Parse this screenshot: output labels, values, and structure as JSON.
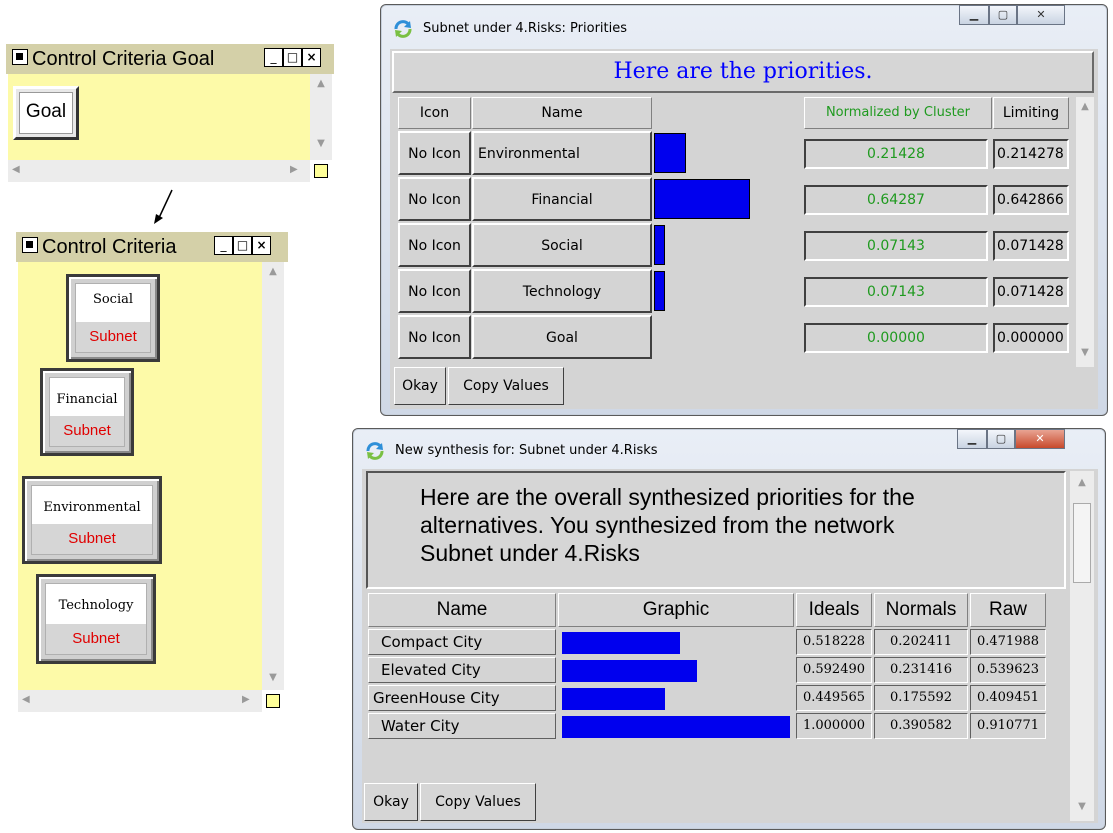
{
  "goal_window": {
    "title": "Control Criteria Goal",
    "buttons": [
      "_",
      "□",
      "×"
    ],
    "node_label": "Goal"
  },
  "criteria_window": {
    "title": "Control Criteria",
    "buttons": [
      "_",
      "□",
      "×"
    ],
    "nodes": [
      {
        "name": "Social",
        "sub": "Subnet"
      },
      {
        "name": "Financial",
        "sub": "Subnet"
      },
      {
        "name": "Environmental",
        "sub": "Subnet"
      },
      {
        "name": "Technology",
        "sub": "Subnet"
      }
    ]
  },
  "priorities_window": {
    "title": "Subnet under 4.Risks: Priorities",
    "heading": "Here are the priorities.",
    "columns": {
      "icon": "Icon",
      "name": "Name",
      "normalized": "Normalized by Cluster",
      "limiting": "Limiting"
    },
    "rows": [
      {
        "icon": "No Icon",
        "name": "Environmental",
        "bar": 0.21428,
        "normalized": "0.21428",
        "limiting": "0.214278"
      },
      {
        "icon": "No Icon",
        "name": "Financial",
        "bar": 0.64287,
        "normalized": "0.64287",
        "limiting": "0.642866"
      },
      {
        "icon": "No Icon",
        "name": "Social",
        "bar": 0.07143,
        "normalized": "0.07143",
        "limiting": "0.071428"
      },
      {
        "icon": "No Icon",
        "name": "Technology",
        "bar": 0.07143,
        "normalized": "0.07143",
        "limiting": "0.071428"
      },
      {
        "icon": "No Icon",
        "name": "Goal",
        "bar": 0.0,
        "normalized": "0.00000",
        "limiting": "0.000000"
      }
    ],
    "okay": "Okay",
    "copy": "Copy Values"
  },
  "synthesis_window": {
    "title": "New synthesis for: Subnet under 4.Risks",
    "heading_lines": [
      "Here are the overall synthesized priorities for the",
      "alternatives.  You synthesized from the network",
      "Subnet under 4.Risks"
    ],
    "columns": {
      "name": "Name",
      "graphic": "Graphic",
      "ideals": "Ideals",
      "normals": "Normals",
      "raw": "Raw"
    },
    "rows": [
      {
        "name": "Compact City",
        "ideal": 0.518228,
        "ideals": "0.518228",
        "normals": "0.202411",
        "raw": "0.471988"
      },
      {
        "name": "Elevated City",
        "ideal": 0.59249,
        "ideals": "0.592490",
        "normals": "0.231416",
        "raw": "0.539623"
      },
      {
        "name": "GreenHouse City",
        "ideal": 0.449565,
        "ideals": "0.449565",
        "normals": "0.175592",
        "raw": "0.409451"
      },
      {
        "name": "Water City",
        "ideal": 1.0,
        "ideals": "1.000000",
        "normals": "0.390582",
        "raw": "0.910771"
      }
    ],
    "okay": "Okay",
    "copy": "Copy Values"
  },
  "colors": {
    "bar": "#0000ee",
    "heading_blue": "#0000ff",
    "green_value": "#1f9a1f",
    "subnet_red": "#e00000",
    "canvas_yellow": "#fdfaa8"
  }
}
